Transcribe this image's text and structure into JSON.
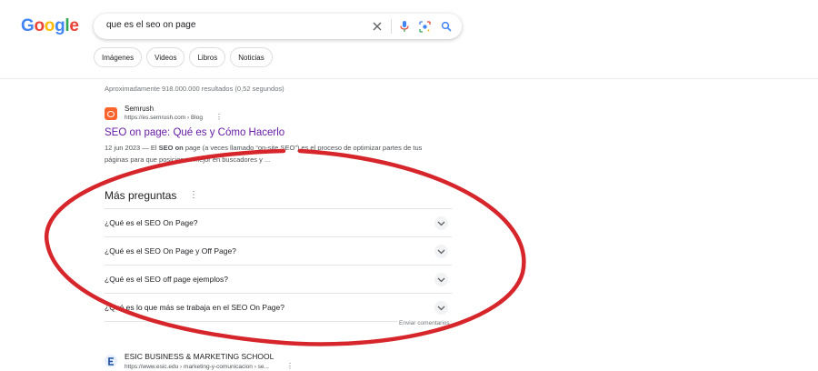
{
  "logo": {
    "letters": [
      "G",
      "o",
      "o",
      "g",
      "l",
      "e"
    ],
    "colors": [
      "#4285f4",
      "#ea4335",
      "#fbbc05",
      "#4285f4",
      "#34a853",
      "#ea4335"
    ]
  },
  "search": {
    "query": "que es el seo on page"
  },
  "chips": [
    "Imágenes",
    "Videos",
    "Libros",
    "Noticias"
  ],
  "stats": "Aproximadamente 918.000.000 resultados (0,52 segundos)",
  "result1": {
    "site": "Semrush",
    "url": "https://es.semrush.com › Blog",
    "title": "SEO on page: Qué es y Cómo Hacerlo",
    "date": "12 jun 2023 —",
    "snippet_pre": "El",
    "snippet_bold": "SEO on",
    "snippet_post": "page (a veces llamado “on-site SEO”) es el proceso de optimizar partes de tus páginas para que posicionen mejor en buscadores y ..."
  },
  "paa": {
    "title": "Más preguntas",
    "questions": [
      "¿Qué es el SEO On Page?",
      "¿Qué es el SEO On Page y Off Page?",
      "¿Qué es el SEO off page ejemplos?",
      "¿Qué es lo que más se trabaja en el SEO On Page?"
    ],
    "feedback": "Enviar comentarios"
  },
  "result2": {
    "site": "ESIC BUSINESS & MARKETING SCHOOL",
    "url": "https://www.esic.edu › marketing-y-comunicacion › se..."
  },
  "colors": {
    "annotation": "#d6262b",
    "visited_link": "#681da8"
  }
}
